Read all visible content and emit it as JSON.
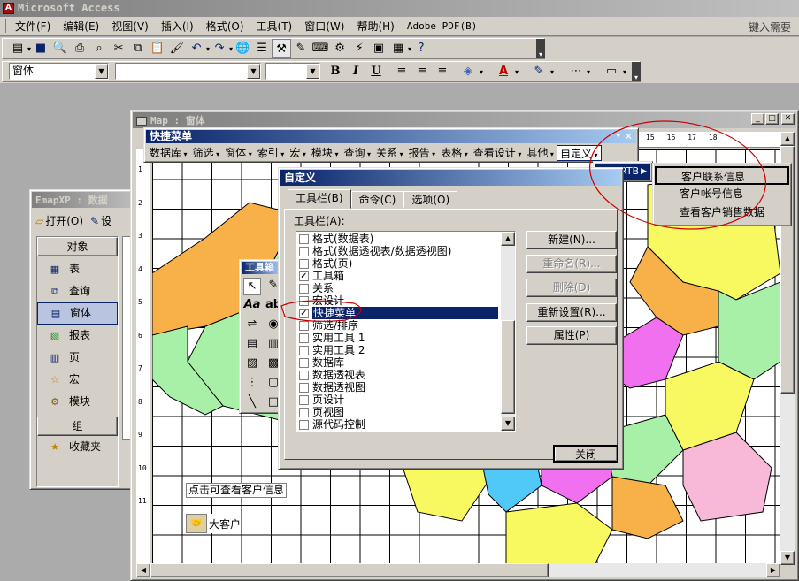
{
  "app": {
    "title": "Microsoft Access",
    "help_placeholder": "键入需要帮"
  },
  "menubar": [
    "文件(F)",
    "编辑(E)",
    "视图(V)",
    "插入(I)",
    "格式(O)",
    "工具(T)",
    "窗口(W)",
    "帮助(H)",
    "Adobe PDF(B)"
  ],
  "format_bar": {
    "object_combo": "窗体",
    "bold": "B",
    "italic": "I",
    "underline": "U"
  },
  "db_window": {
    "title": "EmapXP : 数据",
    "open": "打开(O)",
    "design": "设",
    "objects_header": "对象",
    "items": [
      {
        "label": "表",
        "icon": "table-icon"
      },
      {
        "label": "查询",
        "icon": "query-icon"
      },
      {
        "label": "窗体",
        "icon": "form-icon"
      },
      {
        "label": "报表",
        "icon": "report-icon"
      },
      {
        "label": "页",
        "icon": "page-icon"
      },
      {
        "label": "宏",
        "icon": "macro-icon"
      },
      {
        "label": "模块",
        "icon": "module-icon"
      }
    ],
    "selected": 2,
    "groups_header": "组",
    "favorites": "收藏夹"
  },
  "form_window": {
    "title": "Map : 窗体",
    "ruler_marks": [
      "15",
      "16",
      "17",
      "18"
    ],
    "vruler_marks": [
      "1",
      "2",
      "3",
      "4",
      "5",
      "6",
      "7",
      "8",
      "9",
      "10",
      "11"
    ],
    "label_text": "点击可查看客户信息",
    "big_customer": "大客户"
  },
  "quick_menu": {
    "title": "快捷菜单",
    "items": [
      "数据库",
      "筛选",
      "窗体",
      "索引",
      "宏",
      "模块",
      "查询",
      "关系",
      "报告",
      "表格",
      "查看设计",
      "其他",
      "自定义"
    ],
    "dropdown_first": "RTB",
    "submenu": [
      "客户联系信息",
      "客户帐号信息",
      "查看客户销售数据"
    ]
  },
  "toolbox": {
    "title": "工具箱"
  },
  "customize_dialog": {
    "title": "自定义",
    "tabs": [
      "工具栏(B)",
      "命令(C)",
      "选项(O)"
    ],
    "list_label": "工具栏(A):",
    "toolbars": [
      {
        "label": "格式(数据表)",
        "checked": false
      },
      {
        "label": "格式(数据透视表/数据透视图)",
        "checked": false
      },
      {
        "label": "格式(页)",
        "checked": false
      },
      {
        "label": "工具箱",
        "checked": true
      },
      {
        "label": "关系",
        "checked": false
      },
      {
        "label": "宏设计",
        "checked": false
      },
      {
        "label": "快捷菜单",
        "checked": true
      },
      {
        "label": "筛选/排序",
        "checked": false
      },
      {
        "label": "实用工具 1",
        "checked": false
      },
      {
        "label": "实用工具 2",
        "checked": false
      },
      {
        "label": "数据库",
        "checked": false
      },
      {
        "label": "数据透视表",
        "checked": false
      },
      {
        "label": "数据透视图",
        "checked": false
      },
      {
        "label": "页设计",
        "checked": false
      },
      {
        "label": "页视图",
        "checked": false
      },
      {
        "label": "源代码控制",
        "checked": false
      }
    ],
    "selected_index": 6,
    "buttons": [
      "新建(N)...",
      "重命名(R)...",
      "删除(D)",
      "重新设置(R)...",
      "属性(P)"
    ],
    "close": "关闭"
  },
  "colors": {
    "map_green": "#a8f0a8",
    "map_orange": "#f8b048",
    "map_yellow": "#f8f860",
    "map_magenta": "#f070f0",
    "map_cyan": "#50c8f8",
    "map_pink": "#f8b8d8",
    "annotation_red": "#cc0000"
  }
}
